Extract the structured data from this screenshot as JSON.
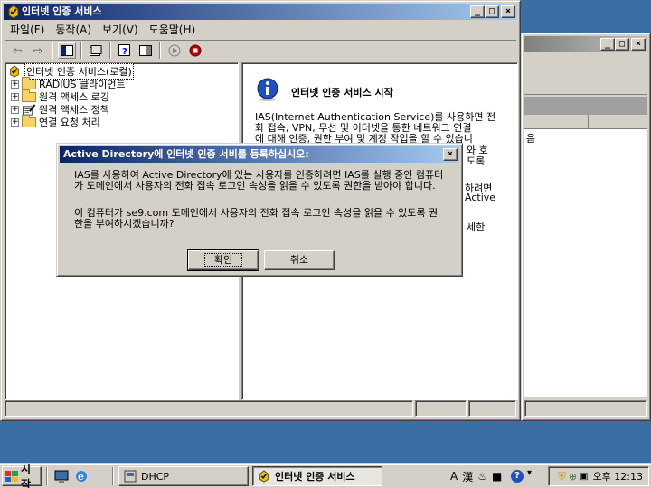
{
  "main_window": {
    "title": "인터넷 인증 서비스",
    "menu": [
      "파일(F)",
      "동작(A)",
      "보기(V)",
      "도움말(H)"
    ],
    "tree": {
      "root": "인터넷 인증 서비스(로컬)",
      "items": [
        "RADIUS 클라이언트",
        "원격 액세스 로깅",
        "원격 액세스 정책",
        "연결 요청 처리"
      ]
    },
    "detail": {
      "heading": "인터넷 인증 서비스 시작",
      "body_lines": [
        "IAS(Internet Authentication Service)를 사용하면 전",
        "화 접속, VPN, 무선 및 이더넷을 통한 네트워크 연결",
        "에 대해 인증, 권한 부여 및 계정 작업을 할 수 있습니"
      ],
      "fragments": [
        "와 호",
        "도록",
        "하려면",
        "Active",
        "세한"
      ]
    }
  },
  "background_window": {
    "fragment": "음"
  },
  "dialog": {
    "title": "Active Directory에 인터넷 인증 서비를 등록하십시오:",
    "message1": "IAS를 사용하여 Active Directory에 있는 사용자를 인증하려면 IAS를 실행 중인 컴퓨터가 도메인에서 사용자의 전화 접속 로그인 속성을 읽을 수 있도록 권한을 받아야 합니다.",
    "message2": "이 컴퓨터가 se9.com 도메인에서 사용자의 전화 접속 로그인 속성을 읽을 수 있도록 권한을 부여하시겠습니까?",
    "ok_label": "확인",
    "cancel_label": "취소"
  },
  "taskbar": {
    "start_label": "시작",
    "tasks": [
      "DHCP",
      "인터넷 인증 서비스"
    ],
    "clock": "오후 12:13",
    "ime_labels": [
      "A",
      "漢"
    ]
  },
  "colors": {
    "desktop": "#3a6ea5",
    "title_active": "#0a246a",
    "title_inactive": "#808080",
    "face": "#d4d0c8"
  }
}
